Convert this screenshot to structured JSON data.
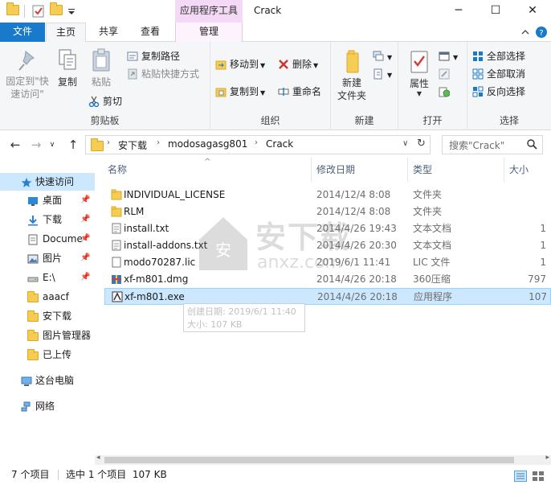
{
  "window": {
    "title": "Crack",
    "contextual_tab_group": "应用程序工具",
    "controls": {
      "minimize": "─",
      "maximize": "☐",
      "close": "✕"
    }
  },
  "ribbon_tabs": {
    "file": "文件",
    "home": "主页",
    "share": "共享",
    "view": "查看",
    "manage": "管理"
  },
  "ribbon": {
    "clipboard": {
      "label": "剪贴板",
      "pin": "固定到\"快速访问\"",
      "copy": "复制",
      "paste": "粘贴",
      "copy_path": "复制路径",
      "paste_shortcut": "粘贴快捷方式",
      "cut": "剪切"
    },
    "organize": {
      "label": "组织",
      "move_to": "移动到",
      "copy_to": "复制到",
      "delete": "删除",
      "rename": "重命名"
    },
    "new": {
      "label": "新建",
      "new_folder": "新建\n文件夹"
    },
    "open": {
      "label": "打开",
      "properties": "属性"
    },
    "select": {
      "label": "选择",
      "select_all": "全部选择",
      "select_none": "全部取消",
      "invert": "反向选择"
    }
  },
  "address": {
    "crumbs": [
      "安下载",
      "modosagasg801",
      "Crack"
    ],
    "search_placeholder": "搜索\"Crack\""
  },
  "nav": {
    "quick_access": "快速访问",
    "items": [
      {
        "label": "桌面",
        "pinned": true
      },
      {
        "label": "下载",
        "pinned": true
      },
      {
        "label": "Docume",
        "pinned": true
      },
      {
        "label": "图片",
        "pinned": true
      },
      {
        "label": "E:\\",
        "pinned": true
      },
      {
        "label": "aaacf",
        "pinned": false
      },
      {
        "label": "安下载",
        "pinned": false
      },
      {
        "label": "图片管理器",
        "pinned": false
      },
      {
        "label": "已上传",
        "pinned": false
      }
    ],
    "this_pc": "这台电脑",
    "network": "网络"
  },
  "columns": {
    "name": "名称",
    "modified": "修改日期",
    "type": "类型",
    "size": "大小"
  },
  "files": [
    {
      "name": "INDIVIDUAL_LICENSE",
      "modified": "2014/12/4 8:08",
      "type": "文件夹",
      "size": "",
      "icon": "folder-icon"
    },
    {
      "name": "RLM",
      "modified": "2014/12/4 8:08",
      "type": "文件夹",
      "size": "",
      "icon": "folder-icon"
    },
    {
      "name": "install.txt",
      "modified": "2014/4/26 19:43",
      "type": "文本文档",
      "size": "1",
      "icon": "text-file-icon"
    },
    {
      "name": "install-addons.txt",
      "modified": "2014/4/26 20:30",
      "type": "文本文档",
      "size": "1",
      "icon": "text-file-icon"
    },
    {
      "name": "modo70287.lic",
      "modified": "2019/6/1 11:41",
      "type": "LIC 文件",
      "size": "1",
      "icon": "lic-file-icon"
    },
    {
      "name": "xf-m801.dmg",
      "modified": "2014/4/26 20:18",
      "type": "360压缩",
      "size": "797",
      "icon": "archive-icon"
    },
    {
      "name": "xf-m801.exe",
      "modified": "2014/4/26 20:18",
      "type": "应用程序",
      "size": "107",
      "icon": "exe-icon",
      "selected": true
    }
  ],
  "tooltip": {
    "created": "创建日期: 2019/6/1 11:40",
    "size": "大小: 107 KB"
  },
  "watermark": {
    "text": "安下载",
    "domain": "anxz.com"
  },
  "status": {
    "item_count": "7 个项目",
    "selection": "选中 1 个项目  107 KB"
  },
  "colors": {
    "file_tab": "#1979ca",
    "selection": "#cce8ff",
    "contextual": "#f3d9f5",
    "folder": "#f6cd52"
  }
}
